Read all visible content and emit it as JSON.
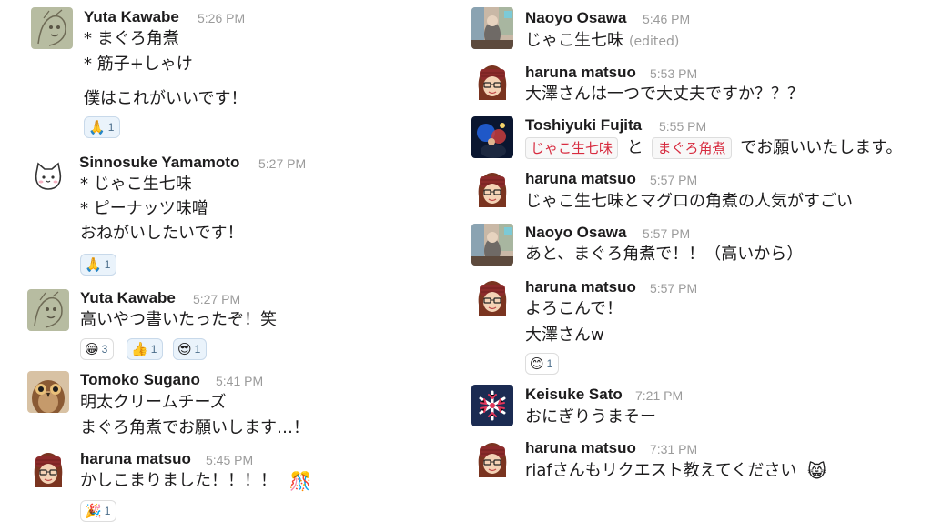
{
  "left": [
    {
      "name": "Yuta Kawabe",
      "time": "5:26 PM",
      "lines": [
        "* まぐろ角煮",
        "* 筋子+しゃけ",
        "僕はこれがいいです！"
      ],
      "reactions": [
        {
          "emoji": "🙏",
          "count": "1",
          "selected": true
        }
      ]
    },
    {
      "name": "Sinnosuke Yamamoto",
      "time": "5:27 PM",
      "lines": [
        "* じゃこ生七味",
        "* ピーナッツ味噌",
        "おねがいしたいです！"
      ],
      "reactions": [
        {
          "emoji": "🙏",
          "count": "1",
          "selected": true
        }
      ]
    },
    {
      "name": "Yuta Kawabe",
      "time": "5:27 PM",
      "lines": [
        "高いやつ書いたったぞ！笑"
      ],
      "reactions": [
        {
          "emoji": "😁",
          "count": "3",
          "selected": false
        },
        {
          "emoji": "👍",
          "count": "1",
          "selected": true
        },
        {
          "emoji": "😎",
          "count": "1",
          "selected": true
        }
      ]
    },
    {
      "name": "Tomoko Sugano",
      "time": "5:41 PM",
      "lines": [
        "明太クリームチーズ",
        "まぐろ角煮でお願いします…！"
      ],
      "reactions": []
    },
    {
      "name": "haruna matsuo",
      "time": "5:45 PM",
      "lines": [
        "かしこまりました！！！！"
      ],
      "inline_emoji": "🎊",
      "reactions": [
        {
          "emoji": "🎉",
          "count": "1",
          "selected": false
        }
      ]
    }
  ],
  "right": [
    {
      "name": "Naoyo Osawa",
      "time": "5:46 PM",
      "lines": [
        "じゃこ生七味"
      ],
      "edited": "(edited)"
    },
    {
      "name": "haruna matsuo",
      "time": "5:53 PM",
      "lines": [
        "大澤さんは一つで大丈夫ですか？？？"
      ]
    },
    {
      "name": "Toshiyuki Fujita",
      "time": "5:55 PM",
      "tag1": "じゃこ生七味",
      "mid": "と",
      "tag2": "まぐろ角煮",
      "tail": "でお願いいたします。"
    },
    {
      "name": "haruna matsuo",
      "time": "5:57 PM",
      "lines": [
        "じゃこ生七味とマグロの角煮の人気がすごい"
      ]
    },
    {
      "name": "Naoyo Osawa",
      "time": "5:57 PM",
      "lines": [
        "あと、まぐろ角煮で！！（高いから）"
      ]
    },
    {
      "name": "haruna matsuo",
      "time": "5:57 PM",
      "lines": [
        "よろこんで！",
        "大澤さんw"
      ],
      "reactions": [
        {
          "emoji": "😊",
          "count": "1",
          "selected": false
        }
      ]
    },
    {
      "name": "Keisuke Sato",
      "time": "7:21 PM",
      "lines": [
        "おにぎりうまそー"
      ]
    },
    {
      "name": "haruna matsuo",
      "time": "7:31 PM",
      "lines": [
        "riafさんもリクエスト教えてください"
      ],
      "inline_emoji": "😸"
    }
  ],
  "icons": {
    "yuta": "sketch-avatar-icon",
    "sinnosuke": "cat-avatar-icon",
    "tomoko": "owl-avatar-icon",
    "haruna": "girl-avatar-icon",
    "naoyo": "photo-avatar-icon",
    "toshiyuki": "night-photo-avatar-icon",
    "keisuke": "snowflake-avatar-icon"
  },
  "colors": {
    "tag_text": "#d72b3f",
    "reaction_selected_bg": "#eaf3fb",
    "timestamp": "#9b9b9b"
  }
}
